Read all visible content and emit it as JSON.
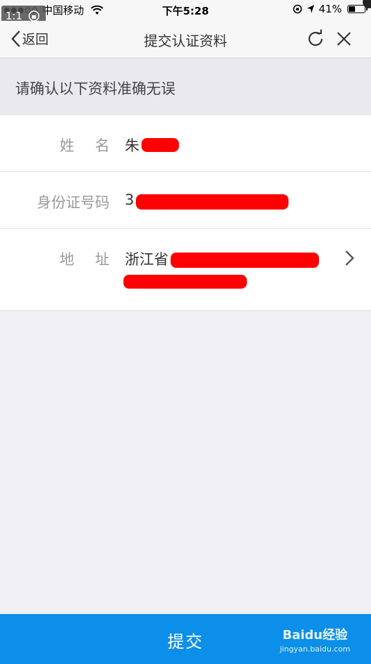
{
  "status_bar": {
    "carrier": "中国移动",
    "time": "下午5:28",
    "battery": "41%",
    "battery_level": 0.41
  },
  "overlay": {
    "zoom": "1:1"
  },
  "nav": {
    "back_label": "返回",
    "title": "提交认证资料"
  },
  "notice": "请确认以下资料准确无误",
  "form": {
    "name_label": "姓名",
    "name_value": "朱",
    "id_label": "身份证号码",
    "id_value": "3",
    "address_label": "地址",
    "address_value": "浙江省"
  },
  "submit_label": "提交",
  "watermark": {
    "brand": "Baidu经验",
    "url": "jingyan.baidu.com"
  },
  "colors": {
    "primary": "#0b8fe8",
    "redaction": "#ff0000"
  }
}
